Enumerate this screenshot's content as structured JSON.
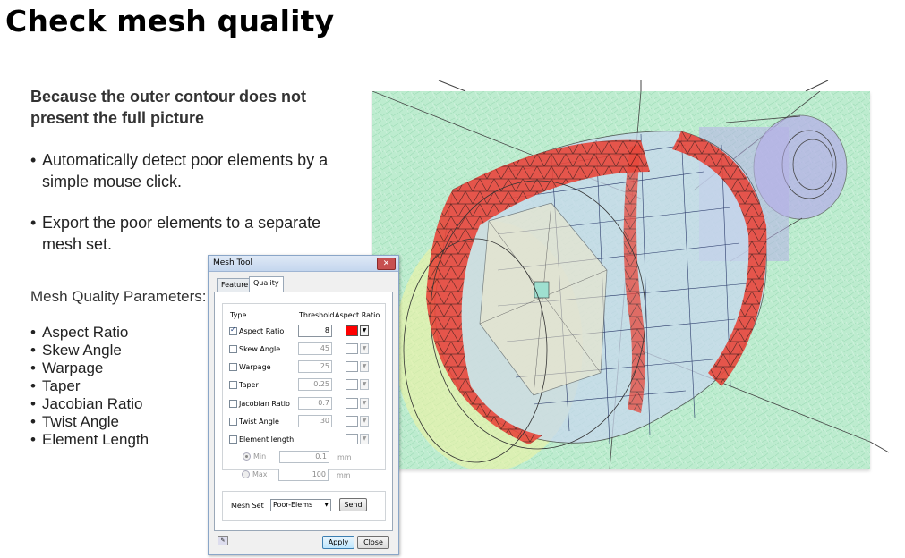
{
  "slide": {
    "title": "Check mesh quality",
    "heading_line1": "Because the outer contour does not",
    "heading_line2": "present the full picture",
    "bullets": [
      "Automatically detect poor elements by a simple mouse click.",
      "Export the poor elements to a separate mesh set."
    ],
    "params_title": "Mesh Quality Parameters:",
    "params": [
      "Aspect Ratio",
      "Skew Angle",
      "Warpage",
      "Taper",
      "Jacobian Ratio",
      "Twist Angle",
      "Element Length"
    ],
    "bullet_glyph": "•"
  },
  "dialog": {
    "title": "Mesh Tool",
    "close_glyph": "✕",
    "tabs": [
      "Feature",
      "Quality"
    ],
    "active_tab": "Quality",
    "col_type": "Type",
    "col_threshold": "Threshold",
    "col_aspect": "Aspect Ratio",
    "rows": [
      {
        "label": "Aspect Ratio",
        "checked": true,
        "threshold": "8",
        "color": "#ff0000"
      },
      {
        "label": "Skew Angle",
        "checked": false,
        "threshold": "45"
      },
      {
        "label": "Warpage",
        "checked": false,
        "threshold": "25"
      },
      {
        "label": "Taper",
        "checked": false,
        "threshold": "0.25"
      },
      {
        "label": "Jacobian Ratio",
        "checked": false,
        "threshold": "0.7"
      },
      {
        "label": "Twist Angle",
        "checked": false,
        "threshold": "30"
      },
      {
        "label": "Element length",
        "checked": false
      }
    ],
    "min_label": "Min",
    "min_value": "0.1",
    "max_label": "Max",
    "max_value": "100",
    "unit": "mm",
    "mesh_set_label": "Mesh Set",
    "mesh_set_value": "Poor-Elems",
    "send_label": "Send",
    "apply_label": "Apply",
    "close_label": "Close",
    "dropdown_glyph": "▼"
  },
  "colors": {
    "view_background": "#bdeccf",
    "poor_elements": "#e8463a",
    "mesh_lines": "#2a3a6a"
  },
  "icons": {
    "eraser": "eraser-icon"
  }
}
